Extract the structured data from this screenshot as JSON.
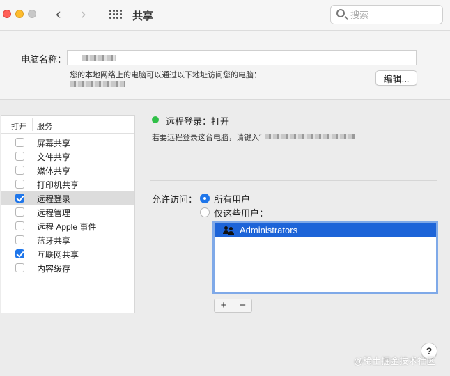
{
  "window": {
    "title": "共享",
    "search_placeholder": "搜索"
  },
  "computer_name": {
    "label": "电脑名称：",
    "address_description": "您的本地网络上的电脑可以通过以下地址访问您的电脑：",
    "edit_button": "编辑..."
  },
  "services": {
    "header_open": "打开",
    "header_service": "服务",
    "items": [
      {
        "name": "屏幕共享",
        "checked": false,
        "selected": false
      },
      {
        "name": "文件共享",
        "checked": false,
        "selected": false
      },
      {
        "name": "媒体共享",
        "checked": false,
        "selected": false
      },
      {
        "name": "打印机共享",
        "checked": false,
        "selected": false
      },
      {
        "name": "远程登录",
        "checked": true,
        "selected": true
      },
      {
        "name": "远程管理",
        "checked": false,
        "selected": false
      },
      {
        "name": "远程 Apple 事件",
        "checked": false,
        "selected": false
      },
      {
        "name": "蓝牙共享",
        "checked": false,
        "selected": false
      },
      {
        "name": "互联网共享",
        "checked": true,
        "selected": false
      },
      {
        "name": "内容缓存",
        "checked": false,
        "selected": false
      }
    ]
  },
  "detail": {
    "status_text": "远程登录：打开",
    "status_color": "#30c048",
    "hint": "若要远程登录这台电脑，请键入“",
    "access_label": "允许访问：",
    "option_all": "所有用户",
    "option_only": "仅这些用户：",
    "selected_option": "所有用户",
    "users": [
      "Administrators"
    ]
  },
  "controls": {
    "plus": "+",
    "minus": "−",
    "help": "?"
  },
  "watermark": "@稀土掘金技术社区",
  "colors": {
    "accent": "#1f76ea",
    "selection": "#1d64d8"
  }
}
